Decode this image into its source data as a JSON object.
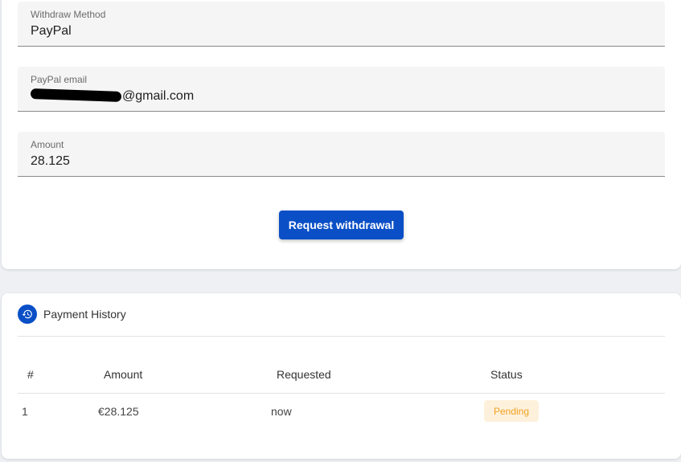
{
  "form": {
    "method": {
      "label": "Withdraw Method",
      "value": "PayPal"
    },
    "email": {
      "label": "PayPal email",
      "value": "@gmail.com"
    },
    "amount": {
      "label": "Amount",
      "value": "28.125"
    },
    "submit_label": "Request withdrawal"
  },
  "history": {
    "title": "Payment History",
    "icon": "history-icon",
    "columns": [
      "#",
      "Amount",
      "Requested",
      "Status"
    ],
    "rows": [
      {
        "index": "1",
        "amount": "€28.125",
        "requested": "now",
        "status": "Pending"
      }
    ]
  },
  "colors": {
    "primary": "#0a4fc6",
    "pending_text": "#f0a020",
    "pending_bg": "#fdf1dc"
  }
}
